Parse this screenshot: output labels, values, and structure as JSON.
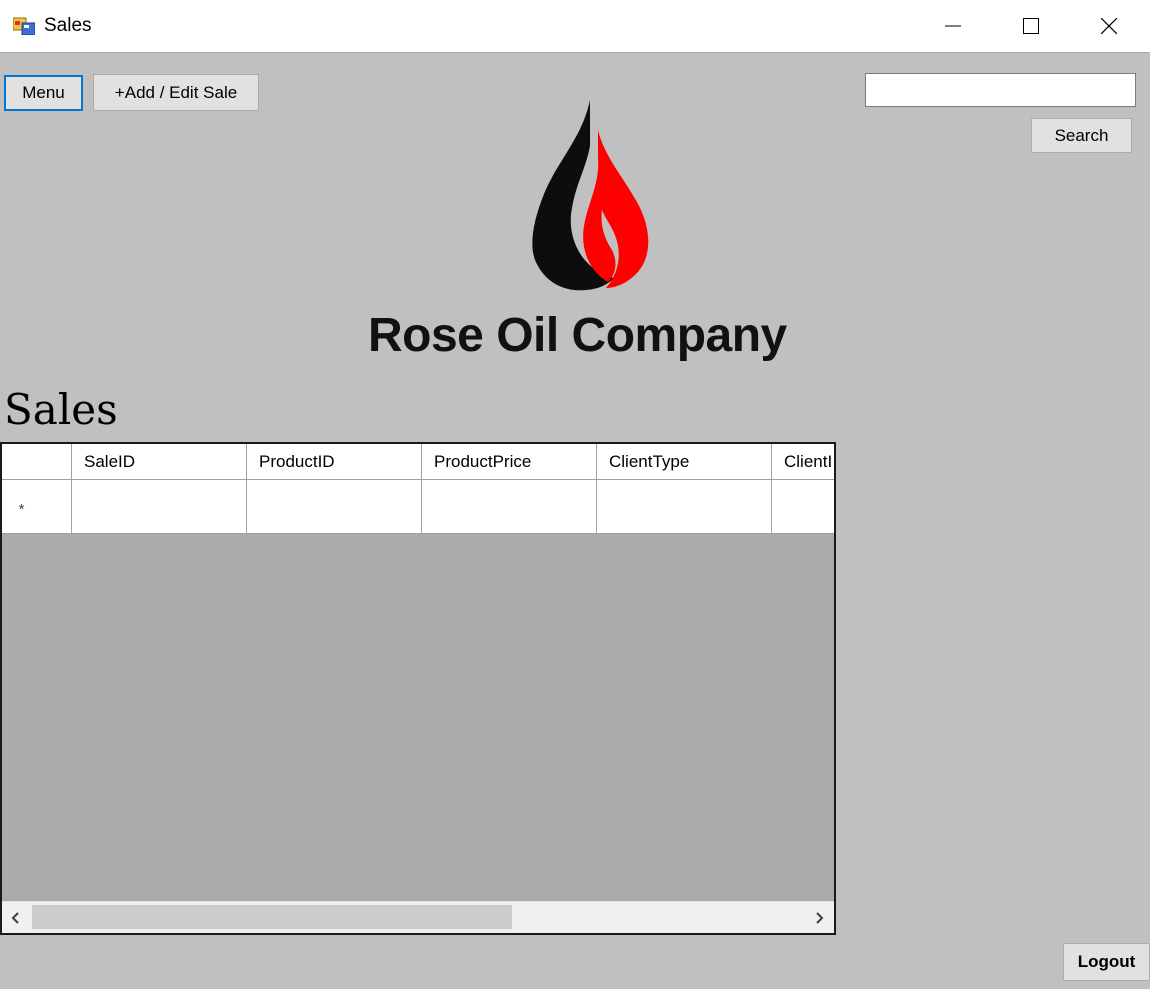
{
  "window": {
    "title": "Sales",
    "controls": {
      "minimize_icon": "minimize-icon",
      "maximize_icon": "maximize-icon",
      "close_icon": "close-icon"
    }
  },
  "toolbar": {
    "menu_label": "Menu",
    "add_edit_label": "+Add / Edit Sale",
    "search_value": "",
    "search_button_label": "Search"
  },
  "brand": {
    "company_name": "Rose Oil Company",
    "logo_icon": "oil-flame-logo",
    "colors": {
      "drop": "#0d0d0d",
      "flame": "#ff0000"
    }
  },
  "section": {
    "title": "Sales"
  },
  "grid": {
    "columns": [
      "SaleID",
      "ProductID",
      "ProductPrice",
      "ClientType",
      "ClientI"
    ],
    "new_row_marker": "*",
    "rows": []
  },
  "footer": {
    "logout_label": "Logout"
  }
}
